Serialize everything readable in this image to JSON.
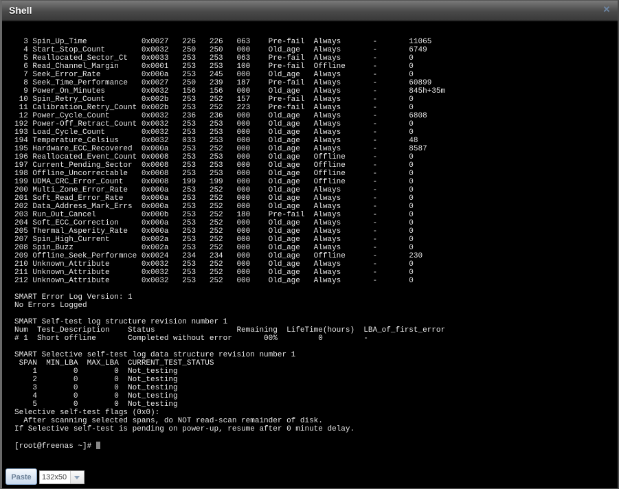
{
  "window": {
    "title": "Shell",
    "close_icon": "close-icon"
  },
  "terminal": {
    "lines": [
      "  3 Spin_Up_Time            0x0027   226   226   063    Pre-fail  Always       -       11065",
      "  4 Start_Stop_Count        0x0032   250   250   000    Old_age   Always       -       6749",
      "  5 Reallocated_Sector_Ct   0x0033   253   253   063    Pre-fail  Always       -       0",
      "  6 Read_Channel_Margin     0x0001   253   253   100    Pre-fail  Offline      -       0",
      "  7 Seek_Error_Rate         0x000a   253   245   000    Old_age   Always       -       0",
      "  8 Seek_Time_Performance   0x0027   250   239   187    Pre-fail  Always       -       60899",
      "  9 Power_On_Minutes        0x0032   156   156   000    Old_age   Always       -       845h+35m",
      " 10 Spin_Retry_Count        0x002b   253   252   157    Pre-fail  Always       -       0",
      " 11 Calibration_Retry_Count 0x002b   253   252   223    Pre-fail  Always       -       0",
      " 12 Power_Cycle_Count       0x0032   236   236   000    Old_age   Always       -       6808",
      "192 Power-Off_Retract_Count 0x0032   253   253   000    Old_age   Always       -       0",
      "193 Load_Cycle_Count        0x0032   253   253   000    Old_age   Always       -       0",
      "194 Temperature_Celsius     0x0032   033   253   000    Old_age   Always       -       48",
      "195 Hardware_ECC_Recovered  0x000a   253   252   000    Old_age   Always       -       8587",
      "196 Reallocated_Event_Count 0x0008   253   253   000    Old_age   Offline      -       0",
      "197 Current_Pending_Sector  0x0008   253   253   000    Old_age   Offline      -       0",
      "198 Offline_Uncorrectable   0x0008   253   253   000    Old_age   Offline      -       0",
      "199 UDMA_CRC_Error_Count    0x0008   199   199   000    Old_age   Offline      -       0",
      "200 Multi_Zone_Error_Rate   0x000a   253   252   000    Old_age   Always       -       0",
      "201 Soft_Read_Error_Rate    0x000a   253   252   000    Old_age   Always       -       0",
      "202 Data_Address_Mark_Errs  0x000a   253   252   000    Old_age   Always       -       0",
      "203 Run_Out_Cancel          0x000b   253   252   180    Pre-fail  Always       -       0",
      "204 Soft_ECC_Correction     0x000a   253   252   000    Old_age   Always       -       0",
      "205 Thermal_Asperity_Rate   0x000a   253   252   000    Old_age   Always       -       0",
      "207 Spin_High_Current       0x002a   253   252   000    Old_age   Always       -       0",
      "208 Spin_Buzz               0x002a   253   252   000    Old_age   Always       -       0",
      "209 Offline_Seek_Performnce 0x0024   234   234   000    Old_age   Offline      -       230",
      "210 Unknown_Attribute       0x0032   253   252   000    Old_age   Always       -       0",
      "211 Unknown_Attribute       0x0032   253   252   000    Old_age   Always       -       0",
      "212 Unknown_Attribute       0x0032   253   252   000    Old_age   Always       -       0",
      "",
      "SMART Error Log Version: 1",
      "No Errors Logged",
      "",
      "SMART Self-test log structure revision number 1",
      "Num  Test_Description    Status                  Remaining  LifeTime(hours)  LBA_of_first_error",
      "# 1  Short offline       Completed without error       00%         0         -",
      "",
      "SMART Selective self-test log data structure revision number 1",
      " SPAN  MIN_LBA  MAX_LBA  CURRENT_TEST_STATUS",
      "    1        0        0  Not_testing",
      "    2        0        0  Not_testing",
      "    3        0        0  Not_testing",
      "    4        0        0  Not_testing",
      "    5        0        0  Not_testing",
      "Selective self-test flags (0x0):",
      "  After scanning selected spans, do NOT read-scan remainder of disk.",
      "If Selective self-test is pending on power-up, resume after 0 minute delay.",
      ""
    ],
    "prompt": "[root@freenas ~]# "
  },
  "footer": {
    "paste_label": "Paste",
    "size_value": "132x50"
  }
}
